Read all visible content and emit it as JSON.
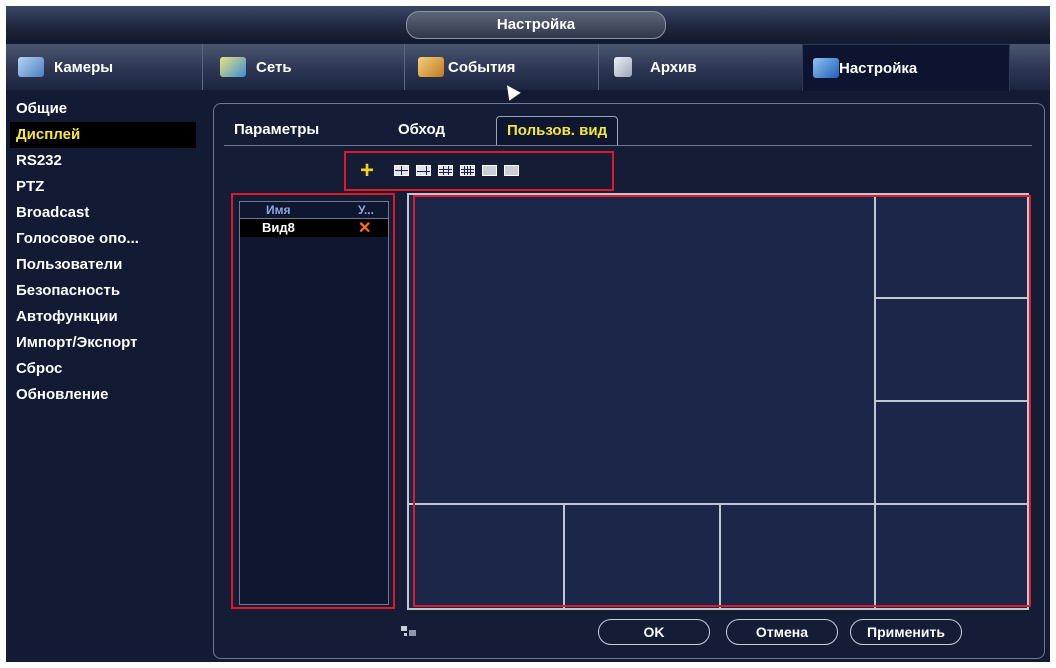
{
  "window": {
    "title": "Настройка"
  },
  "top_tabs": [
    {
      "label": "Камеры",
      "icon": "camera-icon",
      "color": "#6aa0d8"
    },
    {
      "label": "Сеть",
      "icon": "network-icon",
      "color": "#58a8e0"
    },
    {
      "label": "События",
      "icon": "events-icon",
      "color": "#e2a83c"
    },
    {
      "label": "Архив",
      "icon": "archive-icon",
      "color": "#c8cfd8"
    },
    {
      "label": "Настройка",
      "icon": "settings-icon",
      "color": "#3a7ad0",
      "active": true
    }
  ],
  "sidebar": {
    "items": [
      {
        "label": "Общие"
      },
      {
        "label": "Дисплей",
        "active": true
      },
      {
        "label": "RS232"
      },
      {
        "label": "PTZ"
      },
      {
        "label": "Broadcast"
      },
      {
        "label": "Голосовое опо..."
      },
      {
        "label": "Пользователи"
      },
      {
        "label": "Безопасность"
      },
      {
        "label": "Автофункции"
      },
      {
        "label": "Импорт/Экспорт"
      },
      {
        "label": "Сброс"
      },
      {
        "label": "Обновление"
      }
    ]
  },
  "sub_tabs": [
    {
      "label": "Параметры"
    },
    {
      "label": "Обход"
    },
    {
      "label": "Пользов. вид",
      "active": true
    }
  ],
  "toolbar": {
    "add_symbol": "+",
    "layout_icons": [
      "layout-4-icon",
      "layout-6-icon",
      "layout-9-icon",
      "layout-16-icon",
      "layout-25-icon",
      "layout-36-icon"
    ]
  },
  "view_list": {
    "headers": {
      "name": "Имя",
      "delete": "У..."
    },
    "rows": [
      {
        "name": "Вид8",
        "delete_symbol": "✕"
      }
    ]
  },
  "buttons": {
    "ok": "OK",
    "cancel": "Отмена",
    "apply": "Применить"
  },
  "colors": {
    "accent_yellow": "#f6e83a",
    "highlight_red": "#e0192a",
    "delete_orange": "#ff6a2a"
  }
}
